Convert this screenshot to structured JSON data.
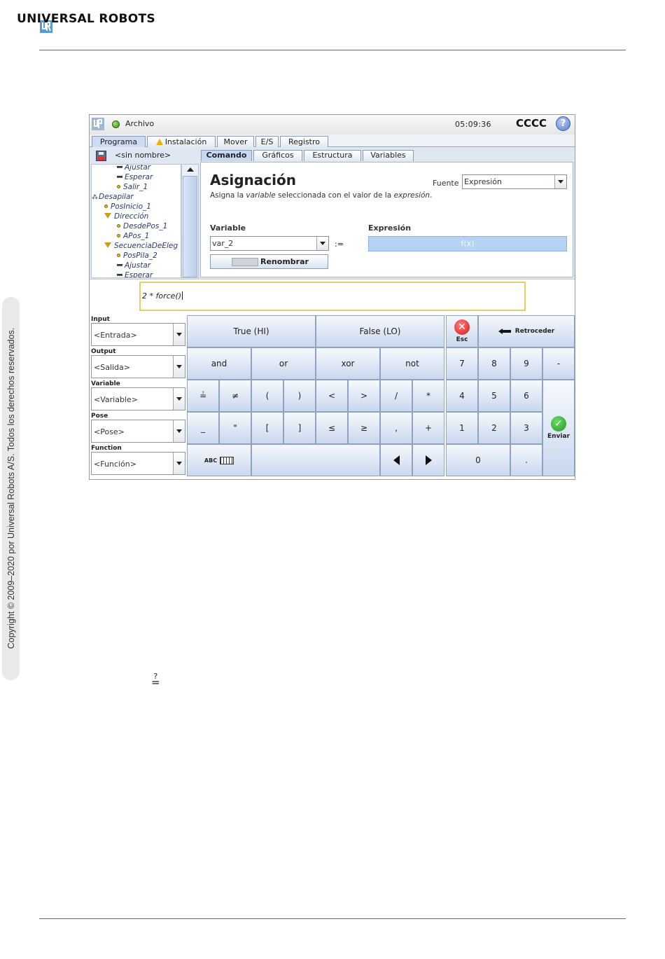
{
  "brand": {
    "name": "UNIVERSAL ROBOTS"
  },
  "copyright": "Copyright © 2009–2020 por Universal Robots A/S. Todos los derechos reservados.",
  "symbol_note": "?\n=",
  "app": {
    "file_menu": "Archivo",
    "time": "05:09:36",
    "robot_name": "CCCC",
    "help": "?",
    "main_tabs": [
      "Programa",
      "Instalación",
      "Mover",
      "E/S",
      "Registro"
    ],
    "file_name": "<sin nombre>",
    "sub_tabs": [
      "Comando",
      "Gráficos",
      "Estructura",
      "Variables"
    ]
  },
  "tree": [
    {
      "label": "Ajustar",
      "icon": "bar-icon"
    },
    {
      "label": "Esperar",
      "icon": "bar-icon"
    },
    {
      "label": "Salir_1",
      "icon": "waypoint-icon"
    },
    {
      "label": "Desapilar",
      "icon": "tree-icon"
    },
    {
      "label": "PosInicio_1",
      "icon": "waypoint-icon"
    },
    {
      "label": "Dirección",
      "icon": "triangle-icon"
    },
    {
      "label": "DesdePos_1",
      "icon": "waypoint-icon"
    },
    {
      "label": "APos_1",
      "icon": "waypoint-icon"
    },
    {
      "label": "SecuenciaDeEleg",
      "icon": "triangle-icon"
    },
    {
      "label": "PosPila_2",
      "icon": "waypoint-icon"
    },
    {
      "label": "Ajustar",
      "icon": "bar-icon"
    },
    {
      "label": "Esperar",
      "icon": "bar-icon"
    }
  ],
  "assign": {
    "title": "Asignación",
    "desc_pre": "Asigna la ",
    "desc_var": "variable",
    "desc_mid": " seleccionada con el valor de la ",
    "desc_expr": "expresión",
    "desc_end": ".",
    "source_label": "Fuente",
    "source_value": "Expresión",
    "variable_label": "Variable",
    "variable_value": "var_2",
    "assign_op": ":=",
    "expression_label": "Expresión",
    "expression_placeholder": "f(x)",
    "rename_button": "Renombrar"
  },
  "expression_text": "2 * force()",
  "keyboard": {
    "side": [
      {
        "label": "Input",
        "value": "<Entrada>"
      },
      {
        "label": "Output",
        "value": "<Salida>"
      },
      {
        "label": "Variable",
        "value": "<Variable>"
      },
      {
        "label": "Pose",
        "value": "<Pose>"
      },
      {
        "label": "Function",
        "value": "<Función>"
      }
    ],
    "true_key": "True (HI)",
    "false_key": "False (LO)",
    "esc": "Esc",
    "backspace": "Retroceder",
    "logic": [
      "and",
      "or",
      "xor",
      "not"
    ],
    "row3": [
      "≟",
      "≠",
      "(",
      ")",
      "<",
      ">",
      "/",
      "*"
    ],
    "row4": [
      "_",
      "\"",
      "[",
      "]",
      "≤",
      "≥",
      ",",
      "+"
    ],
    "abc": "ABC",
    "numpad": [
      "7",
      "8",
      "9",
      "-",
      "4",
      "5",
      "6",
      "1",
      "2",
      "3",
      "0",
      "."
    ],
    "enter": "Enviar"
  }
}
